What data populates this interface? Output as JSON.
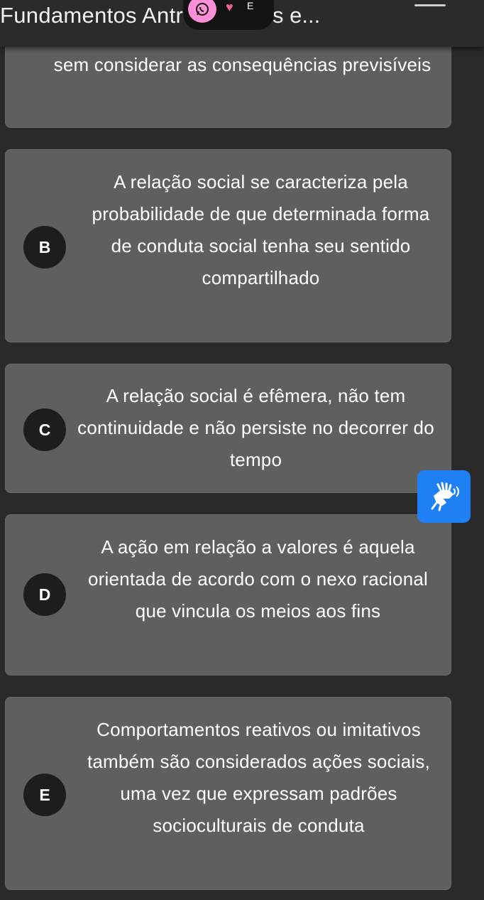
{
  "header": {
    "title_start": "Fundamentos Antro",
    "title_end": "s e...",
    "status_letter": "E"
  },
  "options": {
    "a": {
      "text": "sem considerar as consequências previsíveis"
    },
    "b": {
      "letter": "B",
      "text": "A relação social se caracteriza pela probabilidade de que determinada forma de conduta social tenha seu sentido compartilhado"
    },
    "c": {
      "letter": "C",
      "text": "A relação social é efêmera, não tem continuidade e não persiste no decorrer do tempo"
    },
    "d": {
      "letter": "D",
      "text": "A ação em relação a valores é aquela orientada de acordo com o nexo racional que vincula os meios aos fins"
    },
    "e": {
      "letter": "E",
      "text": "Comportamentos reativos ou imitativos também são considerados ações sociais, uma vez que expressam padrões socioculturais de conduta"
    }
  },
  "icons": {
    "whatsapp": "whatsapp-icon",
    "heart": "heart-icon",
    "menu": "menu-icon",
    "accessibility": "sign-language-icon"
  },
  "colors": {
    "background": "#2a2a2b",
    "card": "#5f5f60",
    "letter_badge": "#1d1d1d",
    "accessibility_button": "#1e80f2"
  }
}
